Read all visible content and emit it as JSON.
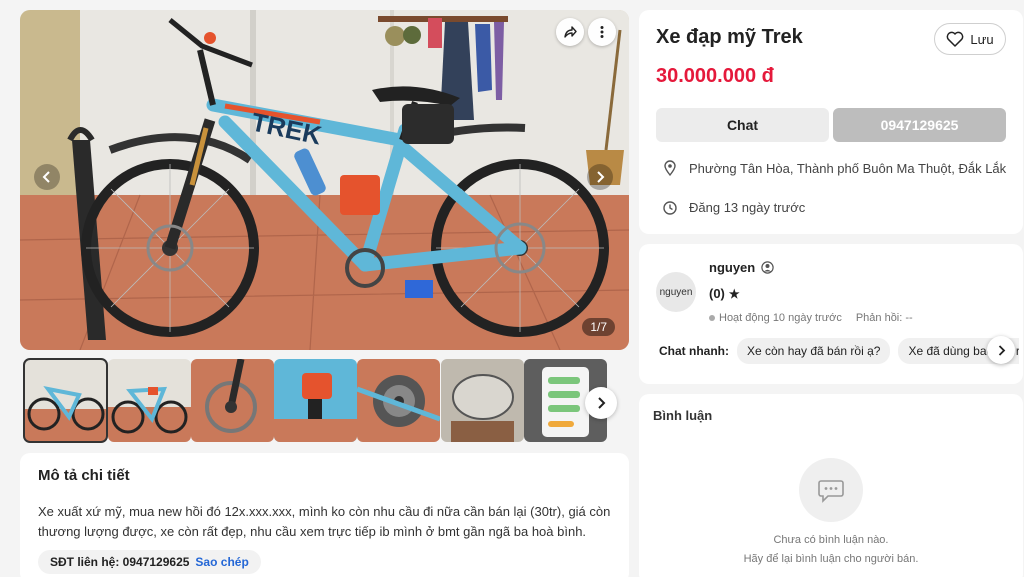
{
  "gallery": {
    "counter": "1/7",
    "frame_text": "TREK",
    "thumbs": [
      "bike-side",
      "bike-side-2",
      "brake-rotor",
      "rear-shock",
      "cassette",
      "helmet",
      "chat-screenshot"
    ]
  },
  "description": {
    "heading": "Mô tả chi tiết",
    "text": "Xe xuất xứ mỹ, mua new hồi đó 12x.xxx.xxx, mình ko còn nhu cầu đi nữa cần bán lại (30tr), giá còn thương lượng được, xe còn rất đẹp, nhu cầu xem trực tiếp ib mình ở bmt gần ngã ba hoà bình.",
    "phone_label": "SĐT liên hệ: 0947129625",
    "copy_label": "Sao chép"
  },
  "product": {
    "title": "Xe đạp mỹ Trek",
    "price": "30.000.000 đ",
    "save_label": "Lưu",
    "chat_label": "Chat",
    "phone_label": "0947129625",
    "location": "Phường Tân Hòa, Thành phố Buôn Ma Thuột, Đắk Lắk",
    "posted": "Đăng 13 ngày trước"
  },
  "seller": {
    "avatar_text": "nguyen",
    "name": "nguyen",
    "rating": "(0)",
    "active": "Hoạt động 10 ngày trước",
    "reply": "Phản hồi: --",
    "quick_label": "Chat nhanh:",
    "quick_chips": [
      "Xe còn hay đã bán rồi ạ?",
      "Xe đã dùng bao lâu rồi ạ?"
    ]
  },
  "comments": {
    "heading": "Bình luận",
    "empty_line1": "Chưa có bình luận nào.",
    "empty_line2": "Hãy để lại bình luận cho người bán."
  },
  "colors": {
    "price": "#e5193b",
    "link": "#2467d6",
    "bike_frame": "#5fb7d8",
    "bike_accent": "#e5532d"
  }
}
